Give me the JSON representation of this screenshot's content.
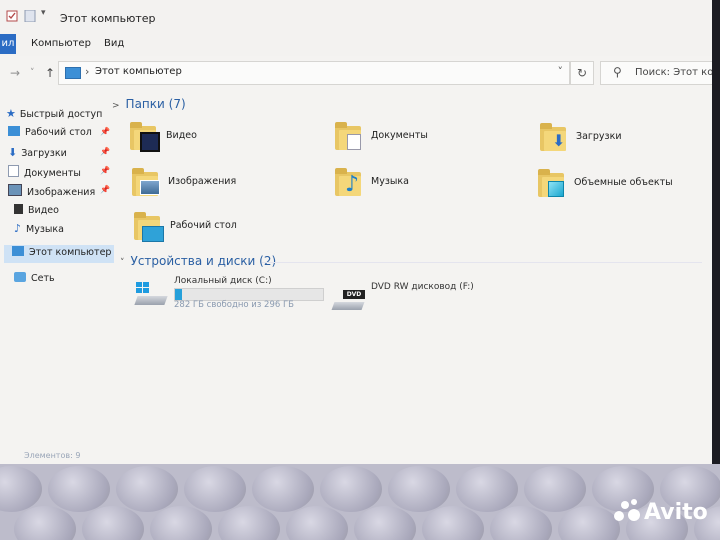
{
  "window": {
    "title": "Этот компьютер"
  },
  "ribbon": {
    "file_tab": "ил",
    "tabs": [
      "Компьютер",
      "Вид"
    ]
  },
  "address": {
    "path": "Этот компьютер",
    "separator": "›"
  },
  "search": {
    "placeholder": "Поиск: Этот компьютер"
  },
  "sidebar": {
    "quick_access": "Быстрый доступ",
    "items": [
      {
        "label": "Рабочий стол",
        "icon": "desktop-icon",
        "pinned": true
      },
      {
        "label": "Загрузки",
        "icon": "download-icon",
        "pinned": true
      },
      {
        "label": "Документы",
        "icon": "documents-icon",
        "pinned": true
      },
      {
        "label": "Изображения",
        "icon": "pictures-icon",
        "pinned": true
      },
      {
        "label": "Видео",
        "icon": "video-icon",
        "pinned": false
      },
      {
        "label": "Музыка",
        "icon": "music-icon",
        "pinned": false
      }
    ],
    "this_pc": "Этот компьютер",
    "network": "Сеть"
  },
  "folders": {
    "header": "Папки (7)",
    "items": [
      {
        "label": "Видео",
        "icon": "video-folder-icon"
      },
      {
        "label": "Документы",
        "icon": "documents-folder-icon"
      },
      {
        "label": "Загрузки",
        "icon": "downloads-folder-icon"
      },
      {
        "label": "Изображения",
        "icon": "pictures-folder-icon"
      },
      {
        "label": "Музыка",
        "icon": "music-folder-icon"
      },
      {
        "label": "Объемные объекты",
        "icon": "3d-objects-folder-icon"
      },
      {
        "label": "Рабочий стол",
        "icon": "desktop-folder-icon"
      }
    ]
  },
  "devices": {
    "header": "Устройства и диски (2)",
    "items": [
      {
        "label": "Локальный диск (C:)",
        "info": "282 ГБ свободно из 296 ГБ",
        "used_fraction": 0.05,
        "icon": "windows-drive-icon"
      },
      {
        "label": "DVD RW дисковод (F:)",
        "icon": "dvd-drive-icon"
      }
    ]
  },
  "status": {
    "text": "Элементов: 9"
  },
  "watermark": {
    "text": "Avito"
  },
  "colors": {
    "accent": "#2b6cc4",
    "selection": "#cfe2f5",
    "group_header": "#2a5fa3"
  }
}
